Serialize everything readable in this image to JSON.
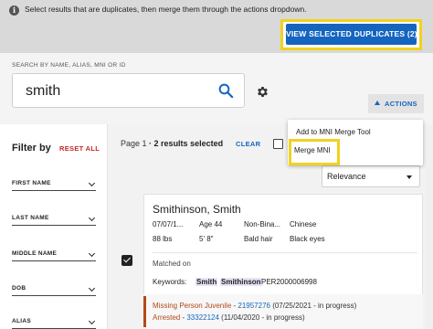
{
  "banner": {
    "info_icon": "info-icon",
    "text": "Select results that are duplicates, then merge them through the actions dropdown.",
    "view_duplicates_button": "VIEW SELECTED DUPLICATES (2)"
  },
  "search": {
    "label": "SEARCH BY NAME, ALIAS, MNI OR ID",
    "value": "smith",
    "search_icon": "search-icon",
    "settings_icon": "gear-icon"
  },
  "actions": {
    "button_label": "ACTIONS",
    "caret_icon": "caret-up-icon",
    "menu_items": [
      "Add to MNI Merge Tool",
      "Merge MNI"
    ]
  },
  "filter": {
    "title": "Filter by",
    "reset_label": "RESET ALL",
    "fields": [
      "FIRST NAME",
      "LAST NAME",
      "MIDDLE NAME",
      "DOB",
      "ALIAS"
    ]
  },
  "results": {
    "page_prefix": "Page 1",
    "count_text": "· 2 results selected",
    "clear_label": "CLEAR",
    "sort_value": "Relevance"
  },
  "card": {
    "name": "Smithinson, Smith",
    "attrs_row1": [
      "07/07/1...",
      "Age 44",
      "Non-Bina...",
      "Chinese"
    ],
    "attrs_row2": [
      "88 lbs",
      "5' 8\"",
      "Bald hair",
      "Black eyes"
    ],
    "matched_on": "Matched on",
    "keywords_label": "Keywords:",
    "keywords": [
      "Smith",
      "Smithinson",
      "PER2000006998"
    ],
    "events": [
      {
        "type": "Missing Person Juvenile",
        "sep": " - ",
        "number": "21957276",
        "rest": " (07/25/2021 - in progress)"
      },
      {
        "type": "Arrested",
        "sep": " - ",
        "number": "33322124",
        "rest": " (11/04/2020 - in progress)"
      }
    ]
  },
  "colors": {
    "primary": "#1565c0",
    "highlight": "#f0d21f",
    "reset": "#c62828",
    "event": "#b04a1a"
  }
}
